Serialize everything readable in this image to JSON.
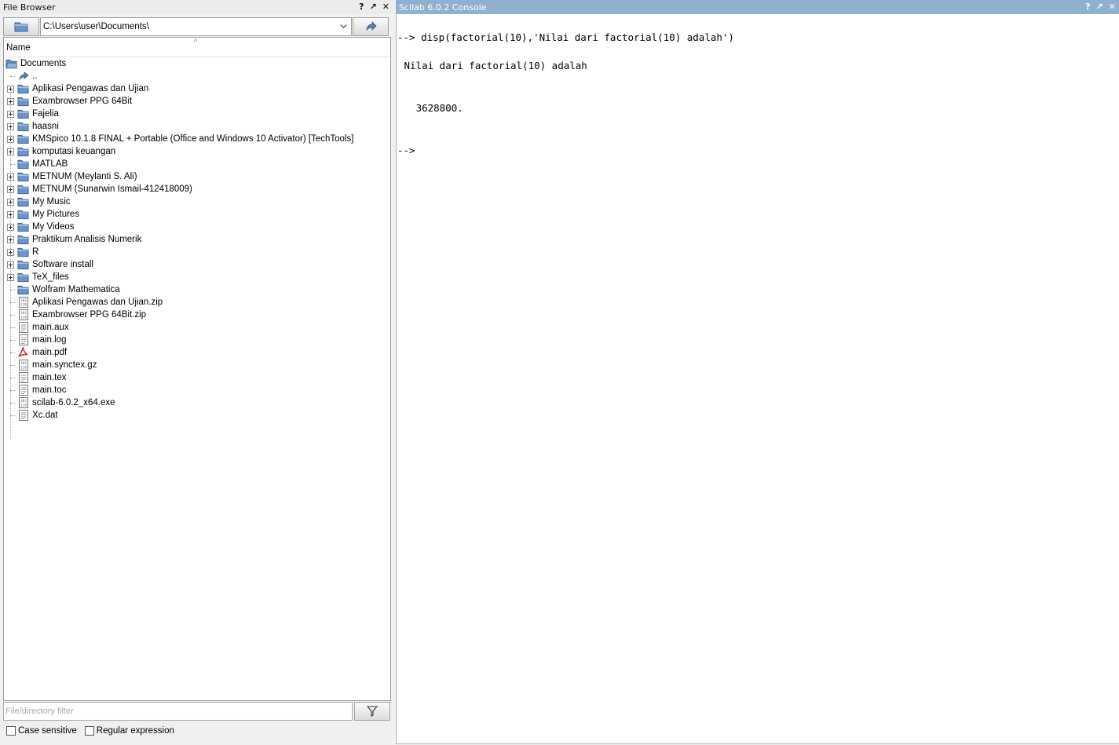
{
  "file_browser": {
    "title": "File Browser",
    "title_buttons": [
      "?",
      "↗",
      "✕"
    ],
    "path": "C:\\Users\\user\\Documents\\",
    "column_header": "Name",
    "root": "Documents",
    "items": [
      {
        "label": "..",
        "type": "up"
      },
      {
        "label": "Aplikasi Pengawas dan Ujian",
        "type": "folder"
      },
      {
        "label": "Exambrowser PPG 64Bit",
        "type": "folder"
      },
      {
        "label": "Fajelia",
        "type": "folder"
      },
      {
        "label": "haasni",
        "type": "folder"
      },
      {
        "label": "KMSpico 10.1.8 FINAL + Portable (Office and Windows 10 Activator) [TechTools]",
        "type": "folder"
      },
      {
        "label": "komputasi keuangan",
        "type": "folder"
      },
      {
        "label": "MATLAB",
        "type": "folder-leaf"
      },
      {
        "label": "METNUM (Meylanti S. Ali)",
        "type": "folder"
      },
      {
        "label": "METNUM (Sunarwin Ismail-412418009)",
        "type": "folder"
      },
      {
        "label": "My Music",
        "type": "folder"
      },
      {
        "label": "My Pictures",
        "type": "folder"
      },
      {
        "label": "My Videos",
        "type": "folder"
      },
      {
        "label": "Praktikum Analisis Numerik",
        "type": "folder"
      },
      {
        "label": "R",
        "type": "folder"
      },
      {
        "label": "Software install",
        "type": "folder"
      },
      {
        "label": "TeX_files",
        "type": "folder"
      },
      {
        "label": "Wolfram Mathematica",
        "type": "folder-leaf"
      },
      {
        "label": "Aplikasi Pengawas dan Ujian.zip",
        "type": "binary"
      },
      {
        "label": "Exambrowser PPG 64Bit.zip",
        "type": "binary"
      },
      {
        "label": "main.aux",
        "type": "text"
      },
      {
        "label": "main.log",
        "type": "text"
      },
      {
        "label": "main.pdf",
        "type": "pdf"
      },
      {
        "label": "main.synctex.gz",
        "type": "binary"
      },
      {
        "label": "main.tex",
        "type": "text"
      },
      {
        "label": "main.toc",
        "type": "text"
      },
      {
        "label": "scilab-6.0.2_x64.exe",
        "type": "binary"
      },
      {
        "label": "Xc.dat",
        "type": "text"
      }
    ],
    "filter_placeholder": "File/directory filter",
    "case_sensitive_label": "Case sensitive",
    "regex_label": "Regular expression"
  },
  "console": {
    "title": "Scilab 6.0.2 Console",
    "title_buttons": [
      "?",
      "↗",
      "✕"
    ],
    "lines": [
      "--> disp(factorial(10),'Nilai dari factorial(10) adalah')",
      " Nilai dari factorial(10) adalah",
      "   3628800.",
      "-->"
    ]
  },
  "colors": {
    "console_title_bg": "#8fb0cf",
    "folder_blue": "#5f8fc4",
    "pdf_red": "#d32020"
  }
}
